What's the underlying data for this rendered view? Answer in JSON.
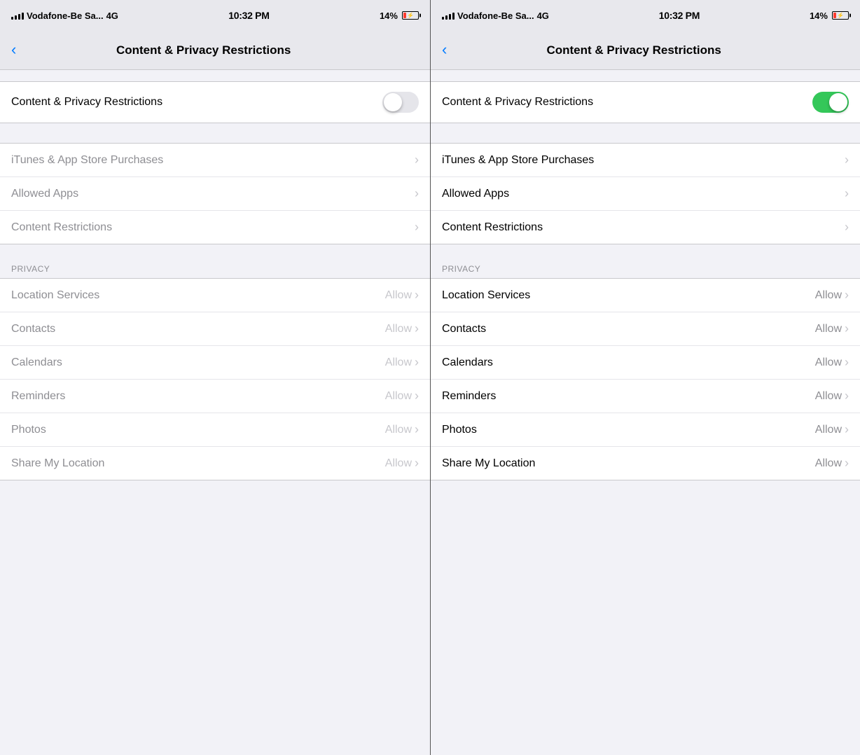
{
  "panels": [
    {
      "id": "left",
      "enabled": false,
      "statusBar": {
        "carrier": "Vodafone-Be Sa...",
        "network": "4G",
        "time": "10:32 PM",
        "battery": "14%"
      },
      "navBar": {
        "backLabel": "Back",
        "title": "Content & Privacy Restrictions"
      },
      "toggleRow": {
        "label": "Content & Privacy Restrictions",
        "state": "off"
      },
      "sections": [
        {
          "id": "main",
          "header": null,
          "rows": [
            {
              "label": "iTunes & App Store Purchases",
              "value": "",
              "hasChevron": true
            },
            {
              "label": "Allowed Apps",
              "value": "",
              "hasChevron": true
            },
            {
              "label": "Content Restrictions",
              "value": "",
              "hasChevron": true
            }
          ]
        },
        {
          "id": "privacy",
          "header": "PRIVACY",
          "rows": [
            {
              "label": "Location Services",
              "value": "Allow",
              "hasChevron": true
            },
            {
              "label": "Contacts",
              "value": "Allow",
              "hasChevron": true
            },
            {
              "label": "Calendars",
              "value": "Allow",
              "hasChevron": true
            },
            {
              "label": "Reminders",
              "value": "Allow",
              "hasChevron": true
            },
            {
              "label": "Photos",
              "value": "Allow",
              "hasChevron": true
            },
            {
              "label": "Share My Location",
              "value": "Allow",
              "hasChevron": true
            }
          ]
        }
      ]
    },
    {
      "id": "right",
      "enabled": true,
      "statusBar": {
        "carrier": "Vodafone-Be Sa...",
        "network": "4G",
        "time": "10:32 PM",
        "battery": "14%"
      },
      "navBar": {
        "backLabel": "Back",
        "title": "Content & Privacy Restrictions"
      },
      "toggleRow": {
        "label": "Content & Privacy Restrictions",
        "state": "on"
      },
      "sections": [
        {
          "id": "main",
          "header": null,
          "rows": [
            {
              "label": "iTunes & App Store Purchases",
              "value": "",
              "hasChevron": true
            },
            {
              "label": "Allowed Apps",
              "value": "",
              "hasChevron": true
            },
            {
              "label": "Content Restrictions",
              "value": "",
              "hasChevron": true
            }
          ]
        },
        {
          "id": "privacy",
          "header": "PRIVACY",
          "rows": [
            {
              "label": "Location Services",
              "value": "Allow",
              "hasChevron": true
            },
            {
              "label": "Contacts",
              "value": "Allow",
              "hasChevron": true
            },
            {
              "label": "Calendars",
              "value": "Allow",
              "hasChevron": true
            },
            {
              "label": "Reminders",
              "value": "Allow",
              "hasChevron": true
            },
            {
              "label": "Photos",
              "value": "Allow",
              "hasChevron": true
            },
            {
              "label": "Share My Location",
              "value": "Allow",
              "hasChevron": true
            }
          ]
        }
      ]
    }
  ]
}
